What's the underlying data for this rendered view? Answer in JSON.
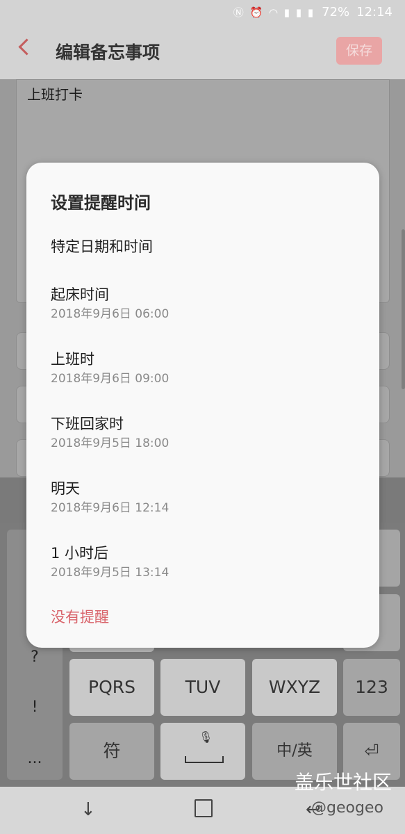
{
  "status_bar": {
    "battery": "72%",
    "time": "12:14",
    "icons": [
      "nfc-icon",
      "alarm-icon",
      "wifi-icon",
      "4g-signal-icon",
      "4g-signal-icon",
      "signal-icon"
    ]
  },
  "app_bar": {
    "title": "编辑备忘事项",
    "save_label": "保存"
  },
  "memo": {
    "text": "上班打卡"
  },
  "dialog": {
    "title": "设置提醒时间",
    "options": [
      {
        "label": "特定日期和时间",
        "sub": ""
      },
      {
        "label": "起床时间",
        "sub": "2018年9月6日 06:00"
      },
      {
        "label": "上班时",
        "sub": "2018年9月6日 09:00"
      },
      {
        "label": "下班回家时",
        "sub": "2018年9月5日 18:00"
      },
      {
        "label": "明天",
        "sub": "2018年9月6日 12:14"
      },
      {
        "label": "1 小时后",
        "sub": "2018年9月5日 13:14"
      }
    ],
    "no_reminder": "没有提醒"
  },
  "keyboard": {
    "symbols": [
      "?",
      "!",
      "..."
    ],
    "row3": [
      "PQRS",
      "TUV",
      "WXYZ",
      "123"
    ],
    "row4": [
      "符",
      "",
      "中/英",
      ""
    ]
  },
  "watermark": {
    "line1": "盖乐世社区",
    "line2": "@geogeo"
  }
}
